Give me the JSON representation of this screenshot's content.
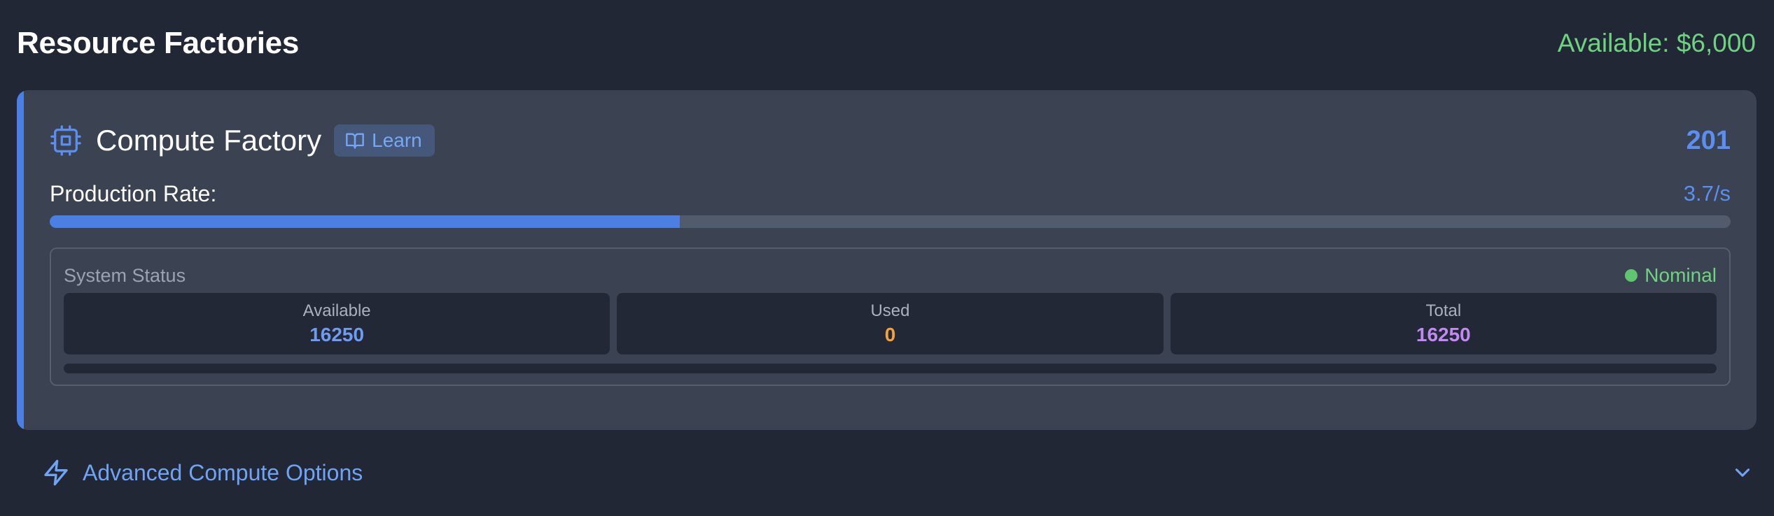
{
  "header": {
    "title": "Resource Factories",
    "budget": "Available: $6,000"
  },
  "factory": {
    "icon": "cpu-icon",
    "title": "Compute Factory",
    "learn_label": "Learn",
    "learn_icon": "book-open-icon",
    "count": "201",
    "accent_color": "#4b7fe3",
    "production": {
      "label": "Production Rate:",
      "value": "3.7/s",
      "fill_fraction": 0.375
    },
    "system_status": {
      "label": "System Status",
      "state": "Nominal",
      "state_color": "#6ed37f",
      "stats": [
        {
          "label": "Available",
          "value": "16250",
          "color": "#6f9bf0"
        },
        {
          "label": "Used",
          "value": "0",
          "color": "#f4a33c"
        },
        {
          "label": "Total",
          "value": "16250",
          "color": "#c18af0"
        }
      ],
      "usage_fraction": 0
    }
  },
  "advanced": {
    "icon": "lightning-bolt-icon",
    "label": "Advanced Compute Options",
    "toggle_icon": "chevron-down-icon"
  }
}
